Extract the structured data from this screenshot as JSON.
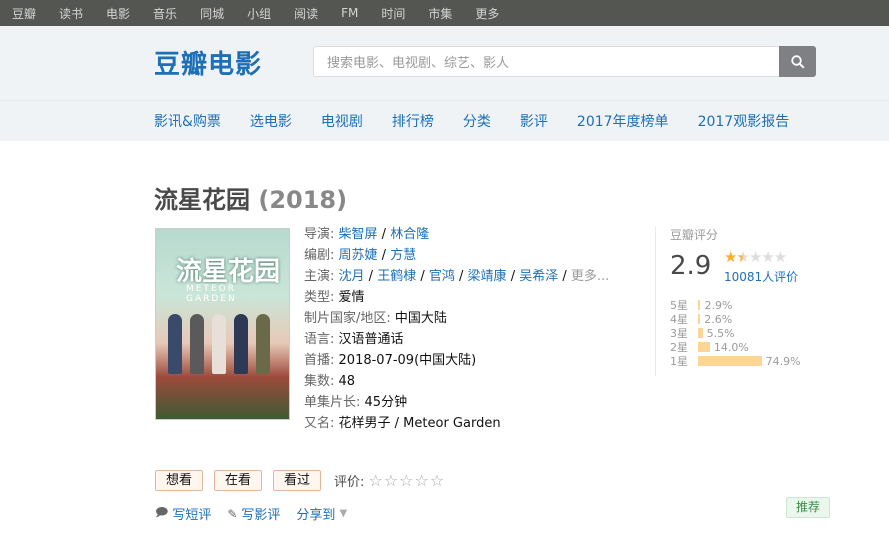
{
  "topbar": {
    "items": [
      "豆瓣",
      "读书",
      "电影",
      "音乐",
      "同城",
      "小组",
      "阅读",
      "FM",
      "时间",
      "市集",
      "更多"
    ]
  },
  "header": {
    "logo": "豆瓣电影",
    "search_placeholder": "搜索电影、电视剧、综艺、影人"
  },
  "nav": {
    "items": [
      "影讯&购票",
      "选电影",
      "电视剧",
      "排行榜",
      "分类",
      "影评",
      "2017年度榜单",
      "2017观影报告"
    ]
  },
  "movie": {
    "title": "流星花园",
    "year": "(2018)",
    "poster_title": "流星花园",
    "poster_subtitle": "METEOR GARDEN",
    "director_label": "导演:",
    "directors": [
      "柴智屏",
      "林合隆"
    ],
    "writer_label": "编剧:",
    "writers": [
      "周苏婕",
      "方慧"
    ],
    "cast_label": "主演:",
    "cast": [
      "沈月",
      "王鹤棣",
      "官鸿",
      "梁靖康",
      "吴希泽"
    ],
    "cast_more": "更多...",
    "sep": " / ",
    "genre_label": "类型:",
    "genre": "爱情",
    "country_label": "制片国家/地区:",
    "country": "中国大陆",
    "language_label": "语言:",
    "language": "汉语普通话",
    "release_label": "首播:",
    "release": "2018-07-09(中国大陆)",
    "episodes_label": "集数:",
    "episodes": "48",
    "runtime_label": "单集片长:",
    "runtime": "45分钟",
    "aka_label": "又名:",
    "aka": "花样男子 / Meteor Garden"
  },
  "rating": {
    "label": "豆瓣评分",
    "score": "2.9",
    "stars_value": 1.5,
    "votes": "10081人评价",
    "distribution": [
      {
        "label": "5星",
        "pct": "2.9%",
        "value": 2.9
      },
      {
        "label": "4星",
        "pct": "2.6%",
        "value": 2.6
      },
      {
        "label": "3星",
        "pct": "5.5%",
        "value": 5.5
      },
      {
        "label": "2星",
        "pct": "14.0%",
        "value": 14.0
      },
      {
        "label": "1星",
        "pct": "74.9%",
        "value": 74.9
      }
    ]
  },
  "actions": {
    "want": "想看",
    "watching": "在看",
    "watched": "看过",
    "rate_label": "评价:"
  },
  "links": {
    "short_review": "写短评",
    "review": "写影评",
    "share": "分享到"
  },
  "recommend": "推荐",
  "colors": {
    "link": "#1d6fb8",
    "topbar": "#545652",
    "star": "#ffac2d",
    "bar": "#ffd596"
  }
}
